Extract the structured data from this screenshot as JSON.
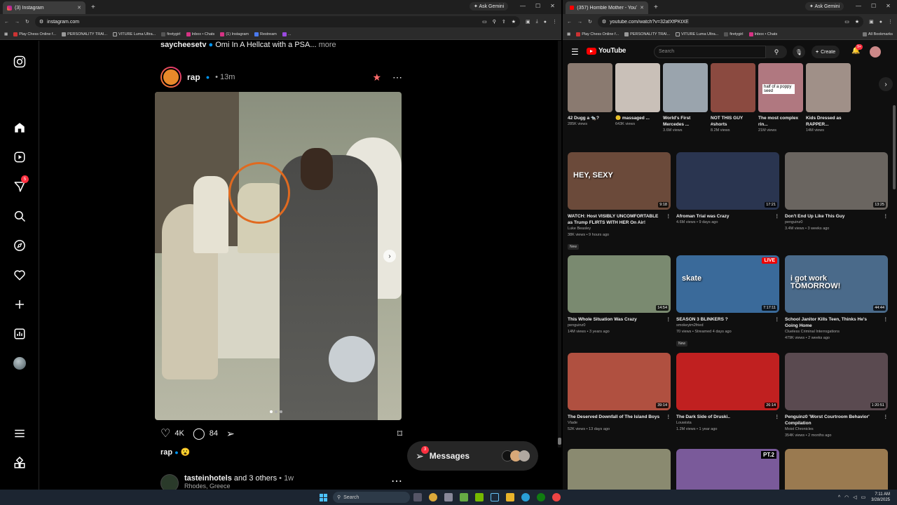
{
  "left": {
    "tab_title": "(3) Instagram",
    "new_tab": "+",
    "ask_gemini": "Ask Gemini",
    "url": "instagram.com",
    "bookmarks": [
      "Play Chess Online f...",
      "PERSONALITY TRAI...",
      "VITURE Luma Ultra...",
      "firetygirl",
      "Inbox • Chats",
      "(1) Instagram",
      "Restream",
      "..."
    ],
    "nav_badge": "5",
    "prev_post": {
      "user": "saycheesetv",
      "caption": "Omi In A Hellcat with a PSA...",
      "more": "more"
    },
    "post": {
      "user": "rap",
      "time": "13m",
      "likes": "4K",
      "comments": "84",
      "caption_user": "rap",
      "caption_emoji": "😮"
    },
    "next_post": {
      "user": "tasteinhotels",
      "others": "and 3 others",
      "time": "1w",
      "sub": "Rhodes, Greece"
    },
    "messages": {
      "label": "Messages",
      "badge": "3"
    }
  },
  "right": {
    "tab_title": "(357) Horrible Mother - YouTub",
    "new_tab": "+",
    "ask_gemini": "Ask Gemini",
    "url": "youtube.com/watch?v=32afXfPKtXE",
    "bookmarks": [
      "Play Chess Online f...",
      "PERSONALITY TRAI...",
      "VITURE Luma Ultra...",
      "firetygirl",
      "Inbox • Chats",
      "All Bookmarks"
    ],
    "logo": "YouTube",
    "search_placeholder": "Search",
    "create": "Create",
    "notif_badge": "9+",
    "shorts": [
      {
        "title": "42 Dugg a 🐀?",
        "views": "285K views",
        "color": "#8a7a70"
      },
      {
        "title": "🙂 massaged ...",
        "views": "643K views",
        "color": "#c9c0b8"
      },
      {
        "title": "World's First Mercedes ...",
        "views": "3.6M views",
        "color": "#9aa4ad"
      },
      {
        "title": "NOT THIS GUY #shorts",
        "views": "8.2M views",
        "color": "#8b4a40"
      },
      {
        "title": "The most complex rin...",
        "views": "21M views",
        "color": "#b07880",
        "overlay": "half of a poppy seed"
      },
      {
        "title": "Kids Dressed as RAPPER...",
        "views": "14M views",
        "color": "#a09088"
      }
    ],
    "videos": [
      {
        "title": "WATCH: Host VISIBLY UNCOMFORTABLE as Trump FLIRTS WITH HER On Air!",
        "channel": "Luke Beasley",
        "meta": "38K views • 9 hours ago",
        "dur": "9:18",
        "badge": "New",
        "color": "#6b4a3a",
        "overlay": "HEY, SEXY"
      },
      {
        "title": "Afroman Trial was Crazy",
        "channel": "",
        "meta": "4.6M views • 9 days ago",
        "dur": "17:21",
        "color": "#2a3550"
      },
      {
        "title": "Don't End Up Like This Guy",
        "channel": "penguinz0",
        "meta": "3.4M views • 3 weeks ago",
        "dur": "13:25",
        "color": "#6a6560"
      },
      {
        "title": "This Whole Situation Was Crazy",
        "channel": "penguinz0",
        "meta": "14M views • 3 years ago",
        "dur": "14:54",
        "color": "#7a8a70"
      },
      {
        "title": "SEASON 3 BLINKERS ?",
        "channel": "smokeyim2fried",
        "meta": "70 views • Streamed 4 days ago",
        "dur": "7:17:11",
        "badge": "New",
        "color": "#3a6a9a",
        "overlay": "skate",
        "live": "LIVE"
      },
      {
        "title": "School Janitor Kills Teen, Thinks He's Going Home",
        "channel": "Clueless Criminal Interrogations",
        "meta": "479K views • 2 weeks ago",
        "dur": "44:44",
        "color": "#4a6a8a",
        "overlay": "i got work TOMORROW!"
      },
      {
        "title": "The Deserved Downfall of The Island Boys",
        "channel": "Vlade",
        "meta": "52K views • 13 days ago",
        "dur": "39:14",
        "color": "#b05040"
      },
      {
        "title": "The Dark Side of Druski..",
        "channel": "Louwista",
        "meta": "1.2M views • 1 year ago",
        "dur": "26:14",
        "color": "#c02020"
      },
      {
        "title": "Penguinz0 'Worst Courtroom Behavior' Compilation",
        "channel": "Moist Chronicles",
        "meta": "354K views • 2 months ago",
        "dur": "1:20:51",
        "color": "#5a4a50"
      }
    ],
    "row4_colors": [
      "#8a8a70",
      "#7a5a9a",
      "#9a7a50"
    ],
    "row4_overlay": "PT.2"
  },
  "taskbar": {
    "search": "Search",
    "time": "7:11 AM",
    "date": "3/28/2025"
  }
}
